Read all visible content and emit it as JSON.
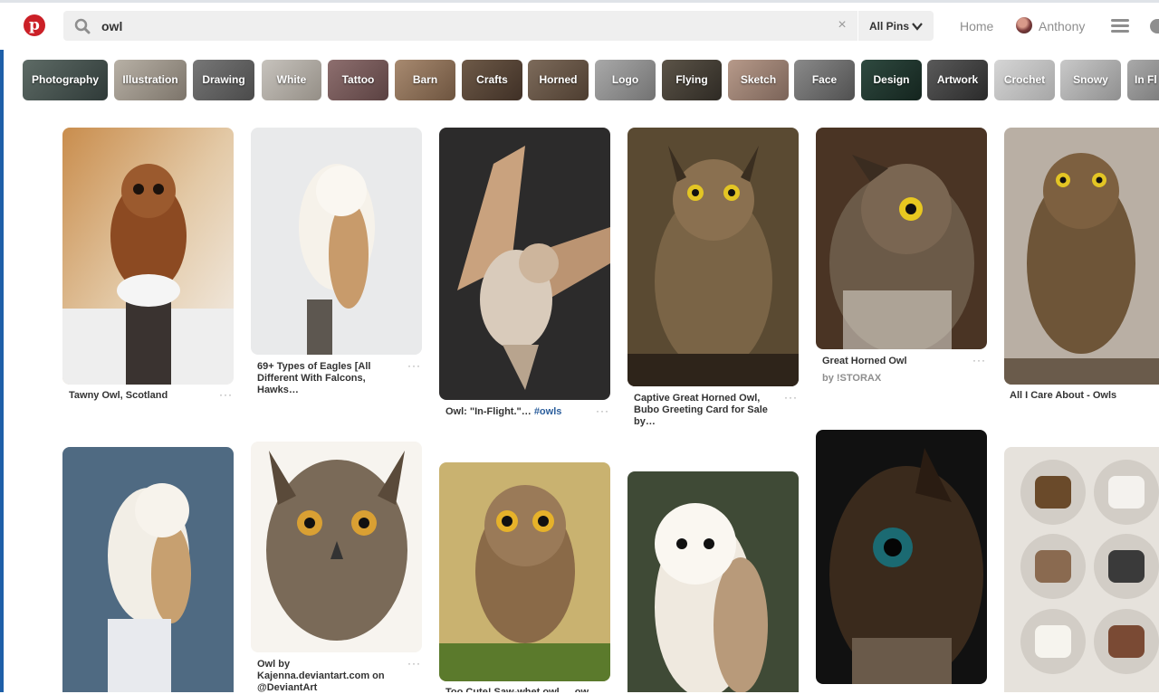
{
  "header": {
    "search_value": "owl",
    "filter_label": "All Pins",
    "nav_home": "Home",
    "user_name": "Anthony",
    "brand_color": "#cb2027",
    "logo_letter": "p"
  },
  "chips": [
    "Photography",
    "Illustration",
    "Drawing",
    "White",
    "Tattoo",
    "Barn",
    "Crafts",
    "Horned",
    "Logo",
    "Flying",
    "Sketch",
    "Face",
    "Design",
    "Artwork",
    "Crochet",
    "Snowy",
    "In Fl"
  ],
  "pins": [
    {
      "caption": "Tawny Owl, Scotland"
    },
    {
      "caption": "69+ Types of Eagles [All Different With Falcons, Hawks…"
    },
    {
      "caption": "Owl: \"In-Flight.\"…",
      "tag": "#owls"
    },
    {
      "caption": "Captive Great Horned Owl, Bubo Greeting Card for Sale by…"
    },
    {
      "caption": "Great Horned Owl",
      "source": "by !STORAX"
    },
    {
      "caption": "All I Care About - Owls"
    },
    {
      "caption": "Owl by Kajenna.deviantart.com on @DeviantArt"
    },
    {
      "caption": "Too Cute! Saw-whet owl … ow"
    }
  ],
  "more_icon_text": "···",
  "clear_icon_text": "×"
}
